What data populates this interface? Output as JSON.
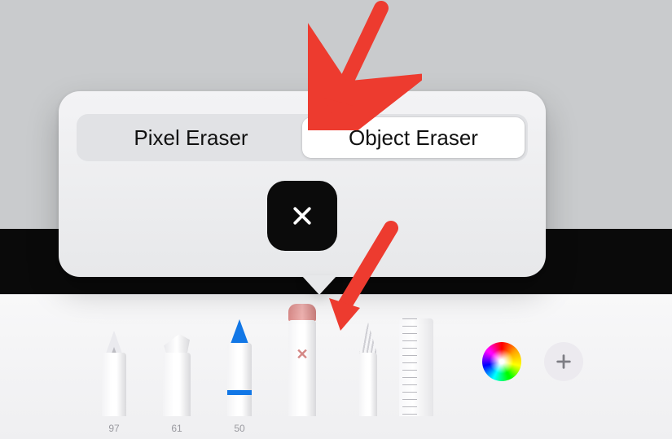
{
  "popover": {
    "segments": {
      "pixel": "Pixel Eraser",
      "object": "Object Eraser"
    },
    "close_icon": "close-icon"
  },
  "tools": {
    "pen": {
      "name": "pen-tool",
      "size": "97"
    },
    "marker": {
      "name": "marker-tool",
      "size": "61"
    },
    "pencil": {
      "name": "pencil-tool",
      "size": "50"
    },
    "eraser": {
      "name": "eraser-tool"
    },
    "lasso": {
      "name": "lasso-tool"
    },
    "ruler": {
      "name": "ruler-tool"
    }
  },
  "palette": {
    "color_well": "color-picker",
    "add_button": "add-tool-button"
  }
}
